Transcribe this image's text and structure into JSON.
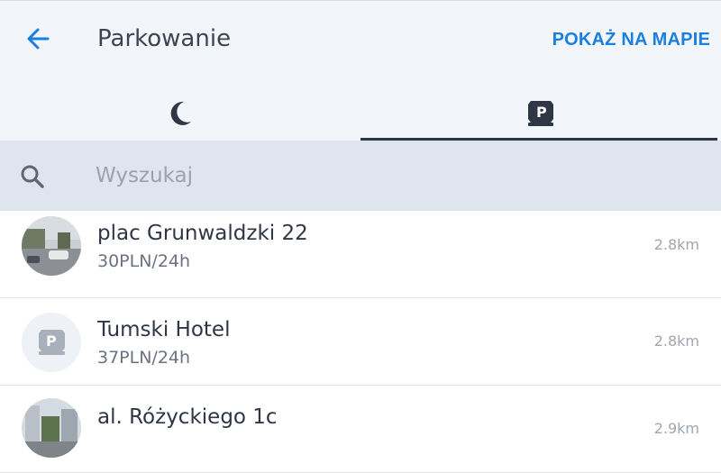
{
  "header": {
    "back_icon": "arrow-left-icon",
    "title": "Parkowanie",
    "map_link": "POKAŻ NA MAPIE",
    "accent_color": "#1a7fe0"
  },
  "tabs": [
    {
      "icon": "moon-icon",
      "selected": false
    },
    {
      "icon": "parking-icon",
      "selected": true
    }
  ],
  "search": {
    "icon": "search-icon",
    "placeholder": "Wyszukaj",
    "value": ""
  },
  "results": [
    {
      "name": "plac Grunwaldzki 22",
      "price": "30PLN/24h",
      "distance": "2.8km",
      "thumbnail": "street-photo"
    },
    {
      "name": "Tumski Hotel",
      "price": "37PLN/24h",
      "distance": "2.8km",
      "thumbnail": "parking-icon"
    },
    {
      "name": "al. Różyckiego 1c",
      "price": "",
      "distance": "2.9km",
      "thumbnail": "street-photo"
    }
  ]
}
